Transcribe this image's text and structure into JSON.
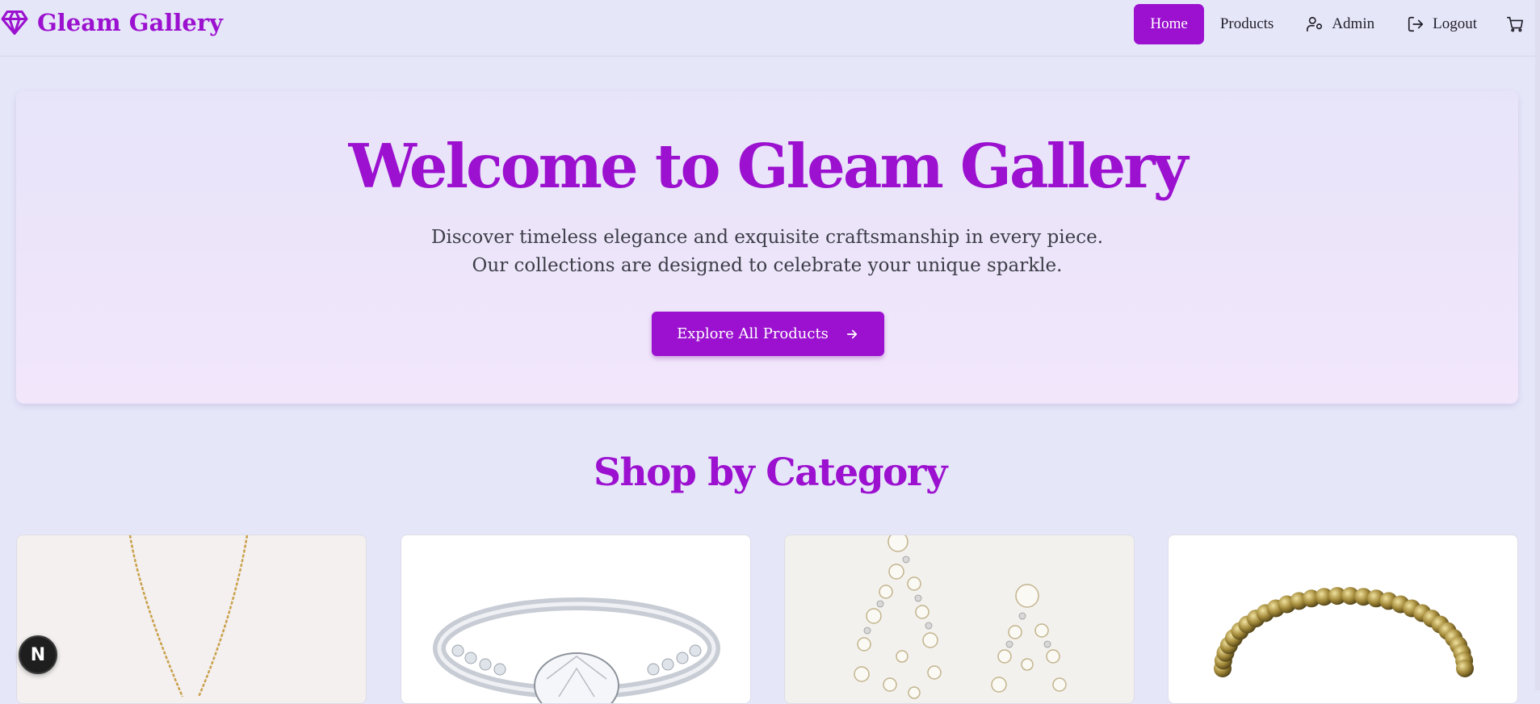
{
  "brand": {
    "name": "Gleam Gallery",
    "icon": "diamond-icon"
  },
  "nav": {
    "items": [
      {
        "label": "Home",
        "active": true
      },
      {
        "label": "Products",
        "active": false
      },
      {
        "label": "Admin",
        "icon": "user-settings-icon",
        "active": false
      },
      {
        "label": "Logout",
        "icon": "logout-icon",
        "active": false
      }
    ],
    "cart_icon": "cart-icon"
  },
  "hero": {
    "title": "Welcome to Gleam Gallery",
    "subtitle_line1": "Discover timeless elegance and exquisite craftsmanship in every piece.",
    "subtitle_line2": "Our collections are designed to celebrate your unique sparkle.",
    "cta_label": "Explore All Products",
    "cta_icon": "arrow-right-icon"
  },
  "categories": {
    "title": "Shop by Category",
    "cards": [
      {
        "image": "gold-necklace-image"
      },
      {
        "image": "diamond-ring-image"
      },
      {
        "image": "pearl-earrings-image"
      },
      {
        "image": "gold-bead-bracelet-image"
      }
    ]
  },
  "dev_badge": {
    "label": "N"
  },
  "colors": {
    "accent": "#9b11cf",
    "background": "#e6e6f9",
    "text": "#1f1f2a"
  }
}
